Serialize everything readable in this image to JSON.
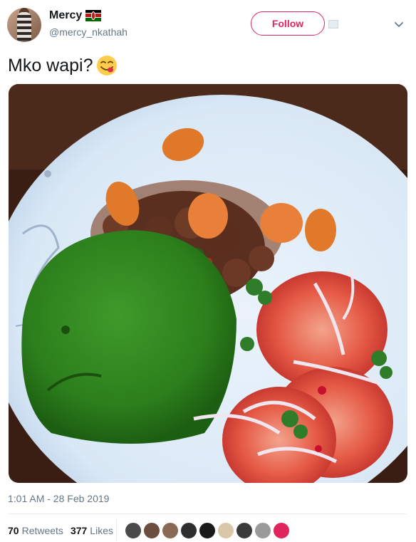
{
  "user": {
    "display_name": "Mercy",
    "handle": "@mercy_nkathah",
    "flag_icon": "kenya-flag-icon"
  },
  "actions": {
    "follow_label": "Follow",
    "more_icon": "chevron-down-icon"
  },
  "tweet": {
    "text": "Mko wapi?",
    "emoji": "face-savoring-food-emoji",
    "image_alt_icon": "food-photo",
    "timestamp": "1:01 AM - 28 Feb 2019"
  },
  "stats": {
    "retweets_count": "70",
    "retweets_label": "Retweets",
    "likes_count": "377",
    "likes_label": "Likes"
  },
  "likers": [
    {
      "color": "#4a4a4a"
    },
    {
      "color": "#6b4e3d"
    },
    {
      "color": "#8a6a55"
    },
    {
      "color": "#2e2e2e"
    },
    {
      "color": "#1a1a1a"
    },
    {
      "color": "#d9c7a8"
    },
    {
      "color": "#3a3a3a"
    },
    {
      "color": "#9a9a9a"
    },
    {
      "color": "#e0245e"
    }
  ]
}
